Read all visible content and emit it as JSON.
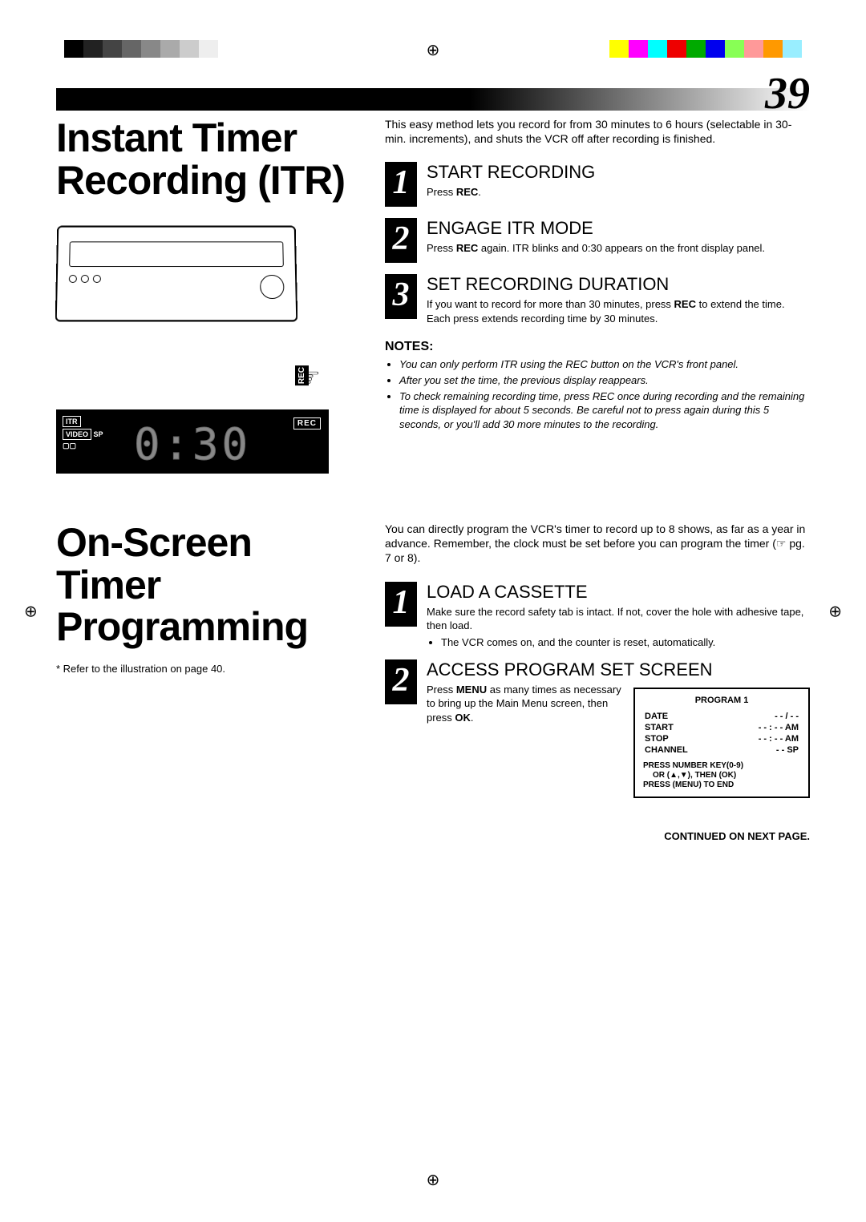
{
  "page_number": "39",
  "section1": {
    "title": "Instant Timer Recording (ITR)",
    "intro": "This easy method lets you record for from 30 minutes to 6 hours (selectable in 30-min. increments), and shuts the VCR off after recording is finished.",
    "display": {
      "itr": "ITR",
      "rec": "REC",
      "video": "VIDEO",
      "sp": "SP",
      "cassette_icon": "▢▢",
      "time": "0:30"
    },
    "rec_button_label": "REC",
    "steps": [
      {
        "num": "1",
        "title": "START RECORDING",
        "text_before": "Press ",
        "text_bold": "REC",
        "text_after": "."
      },
      {
        "num": "2",
        "title": "ENGAGE ITR MODE",
        "text_before": "Press ",
        "text_bold": "REC",
        "text_after": " again. ITR blinks and 0:30 appears on the front display panel."
      },
      {
        "num": "3",
        "title": "SET RECORDING DURATION",
        "text_before": "If you want to record for more than 30 minutes, press ",
        "text_bold": "REC",
        "text_after": " to extend the time. Each press extends recording time by 30 minutes."
      }
    ],
    "notes_title": "NOTES:",
    "notes": [
      "You can only perform ITR using the REC button on the VCR's front panel.",
      "After you set the time, the previous display reappears.",
      "To check remaining recording time, press REC once during recording and the remaining time is displayed for about 5 seconds. Be careful not to press again during this 5 seconds, or you'll add 30 more minutes to the recording."
    ]
  },
  "section2": {
    "title": "On-Screen Timer Programming",
    "ref_note": "* Refer to the illustration on page 40.",
    "intro": "You can directly program the VCR's timer to record up to 8 shows, as far as a year in advance. Remember, the clock must be set before you can program the timer (☞ pg. 7 or 8).",
    "steps": [
      {
        "num": "1",
        "title": "LOAD A CASSETTE",
        "text": "Make sure the record safety tab is intact. If not, cover the hole with adhesive tape, then load.",
        "bullet": "The VCR comes on, and the counter is reset, automatically."
      },
      {
        "num": "2",
        "title": "ACCESS PROGRAM SET SCREEN",
        "text_parts": {
          "p1": "Press ",
          "b1": "MENU",
          "p2": " as many times as necessary to bring up the Main Menu screen, then press ",
          "b2": "OK",
          "p3": "."
        }
      }
    ],
    "program_box": {
      "title": "PROGRAM 1",
      "rows": [
        {
          "label": "DATE",
          "value": "- - / - -"
        },
        {
          "label": "START",
          "value": "- - : - - AM"
        },
        {
          "label": "STOP",
          "value": "- - : - - AM"
        },
        {
          "label": "CHANNEL",
          "value": "- - SP"
        }
      ],
      "footer1": "PRESS NUMBER KEY(0-9)",
      "footer2": "OR (▲,▼), THEN (OK)",
      "footer3": "PRESS (MENU) TO END"
    }
  },
  "continued": "CONTINUED ON NEXT PAGE."
}
